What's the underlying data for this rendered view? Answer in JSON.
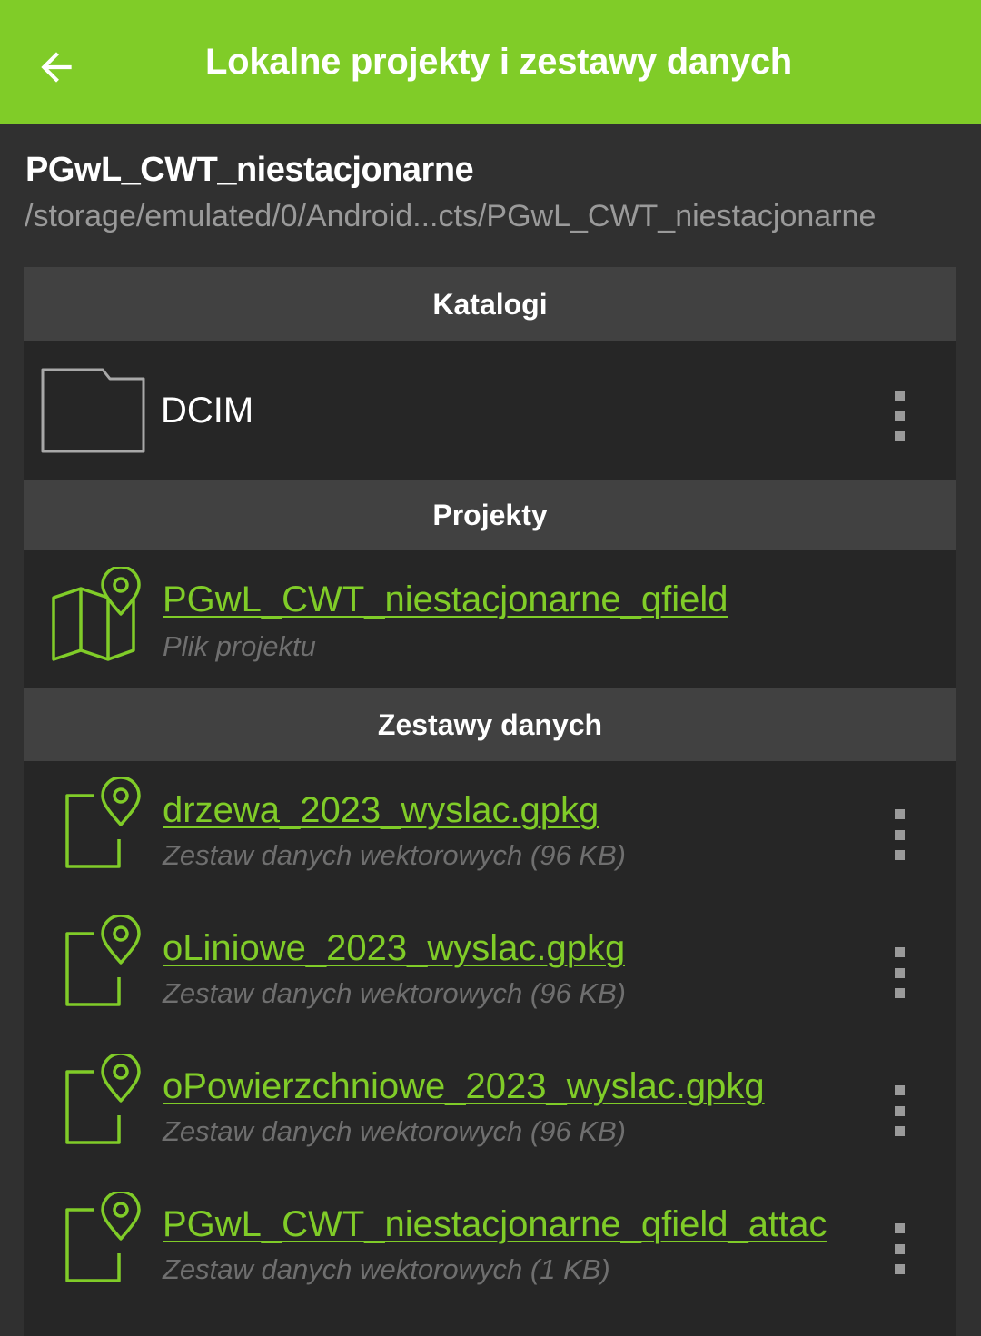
{
  "appbar": {
    "title": "Lokalne projekty i zestawy danych",
    "back_icon": "arrow-left-icon"
  },
  "header": {
    "folder_name": "PGwL_CWT_niestacjonarne",
    "folder_path": "/storage/emulated/0/Android...cts/PGwL_CWT_niestacjonarne"
  },
  "sections": {
    "directories": {
      "label": "Katalogi",
      "items": [
        {
          "name": "DCIM",
          "icon": "folder-icon"
        }
      ]
    },
    "projects": {
      "label": "Projekty",
      "items": [
        {
          "name": "PGwL_CWT_niestacjonarne_qfield",
          "subtitle": "Plik projektu",
          "icon": "map-pin-icon"
        }
      ]
    },
    "datasets": {
      "label": "Zestawy danych",
      "items": [
        {
          "name": "drzewa_2023_wyslac.gpkg",
          "subtitle": "Zestaw danych wektorowych (96 KB)",
          "icon": "dataset-pin-icon"
        },
        {
          "name": "oLiniowe_2023_wyslac.gpkg",
          "subtitle": "Zestaw danych wektorowych (96 KB)",
          "icon": "dataset-pin-icon"
        },
        {
          "name": "oPowierzchniowe_2023_wyslac.gpkg",
          "subtitle": "Zestaw danych wektorowych (96 KB)",
          "icon": "dataset-pin-icon"
        },
        {
          "name": "PGwL_CWT_niestacjonarne_qfield_attachments.zip",
          "subtitle": "Zestaw danych wektorowych (1 KB)",
          "icon": "dataset-pin-icon"
        }
      ]
    }
  },
  "colors": {
    "accent": "#80cc28",
    "background": "#303030",
    "list_background": "#262626",
    "section_header": "#414141",
    "subtitle": "#6f6f6f"
  }
}
